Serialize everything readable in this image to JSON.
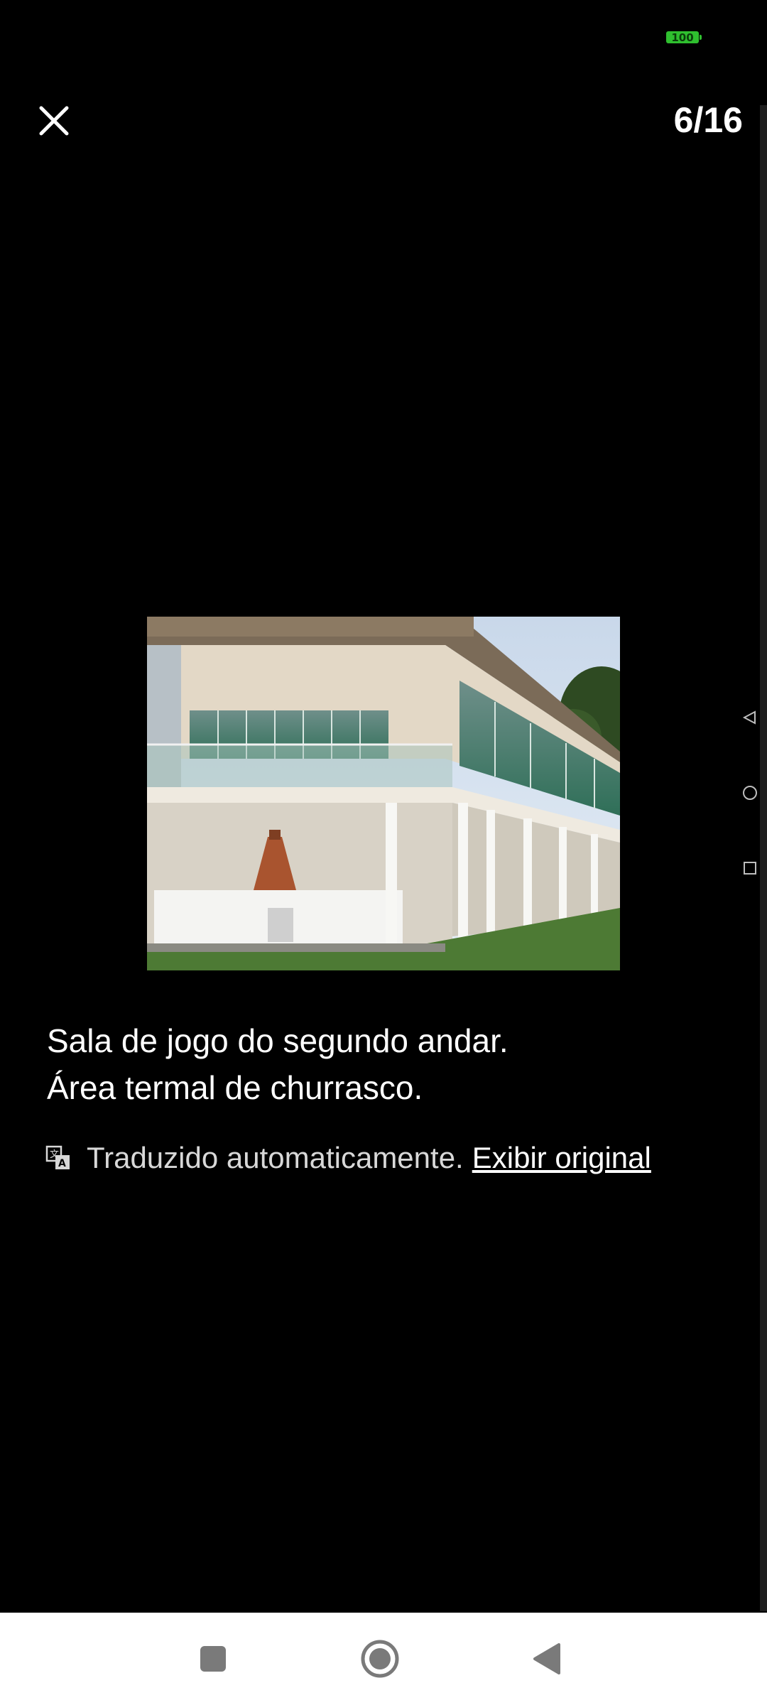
{
  "status": {
    "battery": "100"
  },
  "header": {
    "counter": "6/16"
  },
  "caption": {
    "line1": "Sala de jogo do segundo andar.",
    "line2": "Área termal de churrasco."
  },
  "translation": {
    "note": "Traduzido automaticamente.",
    "link": "Exibir original"
  },
  "icons": {
    "close": "close-icon",
    "translate": "translate-icon",
    "side_back": "triangle-back-icon",
    "side_home": "circle-home-icon",
    "side_recent": "square-recent-icon",
    "nav_recent": "square-recent-icon",
    "nav_home": "circle-home-icon",
    "nav_back": "triangle-back-icon"
  },
  "colors": {
    "background": "#000000",
    "battery": "#2fbf2f",
    "navbar": "#ffffff"
  }
}
